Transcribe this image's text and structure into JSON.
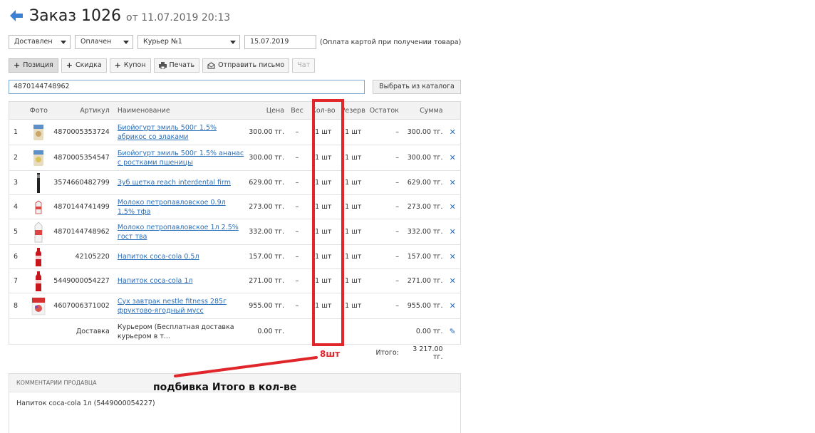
{
  "header": {
    "title": "Заказ 1026",
    "subtitle": "от 11.07.2019 20:13",
    "back_icon": "arrow-left-icon",
    "accent": "#2a6eb8"
  },
  "filters": {
    "status": "Доставлен",
    "payment": "Оплачен",
    "courier": "Курьер №1",
    "date": "15.07.2019",
    "note": "(Оплата картой при получении товара)"
  },
  "toolbar": {
    "position": "Позиция",
    "discount": "Скидка",
    "coupon": "Купон",
    "print": "Печать",
    "send_email": "Отправить письмо",
    "chat": "Чат"
  },
  "search": {
    "value": "4870144748962",
    "catalog_button": "Выбрать из каталога"
  },
  "table": {
    "headers": {
      "photo": "Фото",
      "article": "Артикул",
      "name": "Наименование",
      "price": "Цена",
      "weight": "Вес",
      "qty": "Кол-во",
      "reserve": "Резерв",
      "rest": "Остаток",
      "sum": "Сумма"
    },
    "rows": [
      {
        "num": "1",
        "article": "4870005353724",
        "name": "Биойогурт эмиль 500г 1.5% абрикос со злаками",
        "price": "300.00 тг.",
        "weight": "–",
        "qty": "1 шт",
        "reserve": "1 шт",
        "rest": "–",
        "sum": "300.00 тг."
      },
      {
        "num": "2",
        "article": "4870005354547",
        "name": "Биойогурт эмиль 500г 1.5% ананас с ростками пшеницы",
        "price": "300.00 тг.",
        "weight": "–",
        "qty": "1 шт",
        "reserve": "1 шт",
        "rest": "–",
        "sum": "300.00 тг."
      },
      {
        "num": "3",
        "article": "3574660482799",
        "name": "Зуб щетка reach interdental firm",
        "price": "629.00 тг.",
        "weight": "–",
        "qty": "1 шт",
        "reserve": "1 шт",
        "rest": "–",
        "sum": "629.00 тг."
      },
      {
        "num": "4",
        "article": "4870144741499",
        "name": "Молоко петропавловское 0.9л 1.5% тфа",
        "price": "273.00 тг.",
        "weight": "–",
        "qty": "1 шт",
        "reserve": "1 шт",
        "rest": "–",
        "sum": "273.00 тг."
      },
      {
        "num": "5",
        "article": "4870144748962",
        "name": "Молоко петропавловское 1л 2.5% гост тва",
        "price": "332.00 тг.",
        "weight": "–",
        "qty": "1 шт",
        "reserve": "1 шт",
        "rest": "–",
        "sum": "332.00 тг."
      },
      {
        "num": "6",
        "article": "42105220",
        "name": "Напиток coca-cola 0.5л",
        "price": "157.00 тг.",
        "weight": "–",
        "qty": "1 шт",
        "reserve": "1 шт",
        "rest": "–",
        "sum": "157.00 тг."
      },
      {
        "num": "7",
        "article": "5449000054227",
        "name": "Напиток coca-cola 1л",
        "price": "271.00 тг.",
        "weight": "–",
        "qty": "1 шт",
        "reserve": "1 шт",
        "rest": "–",
        "sum": "271.00 тг."
      },
      {
        "num": "8",
        "article": "4607006371002",
        "name": "Сух завтрак nestle fitness 285г фруктово-ягодный мусс",
        "price": "955.00 тг.",
        "weight": "–",
        "qty": "1 шт",
        "reserve": "1 шт",
        "rest": "–",
        "sum": "955.00 тг."
      }
    ],
    "delivery": {
      "label": "Доставка",
      "name": "Курьером (Бесплатная доставка курьером в т...",
      "price": "0.00 тг.",
      "sum": "0.00 тг."
    },
    "total": {
      "label": "Итого:",
      "value": "3 217.00 тг."
    }
  },
  "comments": {
    "title": "КОММЕНТАРИИ ПРОДАВЦА",
    "text": "Напиток coca-cola 1л (5449000054227)"
  },
  "annotation": {
    "count": "8шт",
    "text": "подбивка Итого в кол-ве",
    "color": "#e0262b"
  }
}
